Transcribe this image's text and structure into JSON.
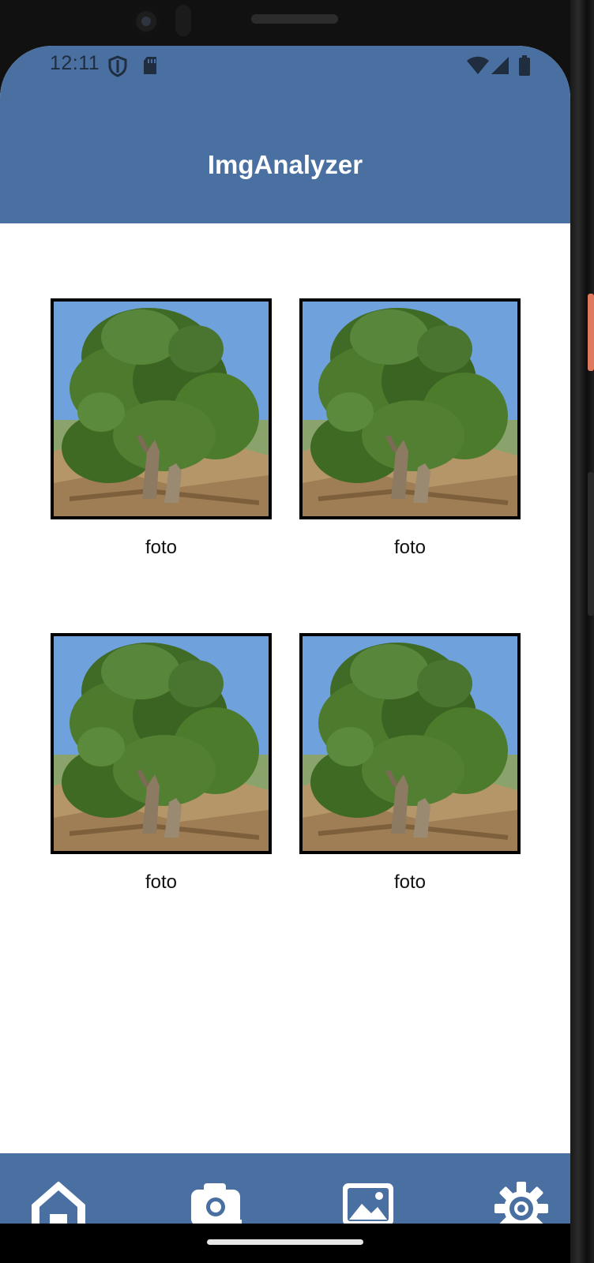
{
  "status_bar": {
    "time": "12:11",
    "icons": [
      "shield-icon",
      "sd-card-icon",
      "wifi-icon",
      "cell-signal-icon",
      "battery-icon"
    ]
  },
  "app_bar": {
    "title": "ImgAnalyzer"
  },
  "gallery": {
    "items": [
      {
        "caption": "foto",
        "image": "tree-photo"
      },
      {
        "caption": "foto",
        "image": "tree-photo"
      },
      {
        "caption": "foto",
        "image": "tree-photo"
      },
      {
        "caption": "foto",
        "image": "tree-photo"
      }
    ]
  },
  "bottom_nav": {
    "items": [
      {
        "icon": "home-icon"
      },
      {
        "icon": "camera-icon"
      },
      {
        "icon": "gallery-icon"
      },
      {
        "icon": "settings-gear-icon"
      }
    ]
  },
  "colors": {
    "primary": "#4a6fa1",
    "title_text": "#ffffff",
    "background": "#ffffff"
  }
}
